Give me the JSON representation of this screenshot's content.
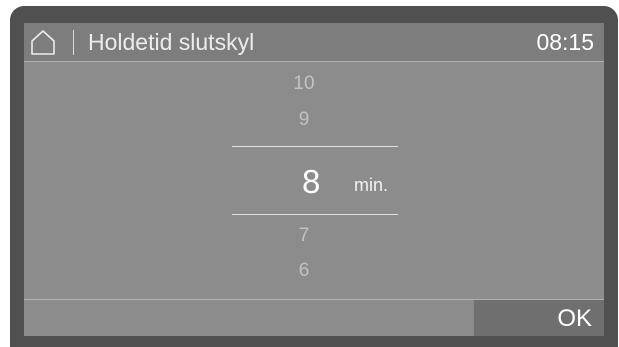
{
  "header": {
    "icon": "home-icon",
    "title": "Holdetid slutskyl",
    "time": "08:15"
  },
  "picker": {
    "above": [
      "10",
      "9"
    ],
    "selected": "8",
    "unit": "min.",
    "below": [
      "7",
      "6"
    ]
  },
  "footer": {
    "ok_label": "OK"
  },
  "colors": {
    "frame": "#505050",
    "screen": "#8c8c8c",
    "header": "#7d7d7d",
    "ok_button": "#6f6f6f",
    "inactive_value": "#c2c2c2",
    "active_value": "#ffffff"
  }
}
